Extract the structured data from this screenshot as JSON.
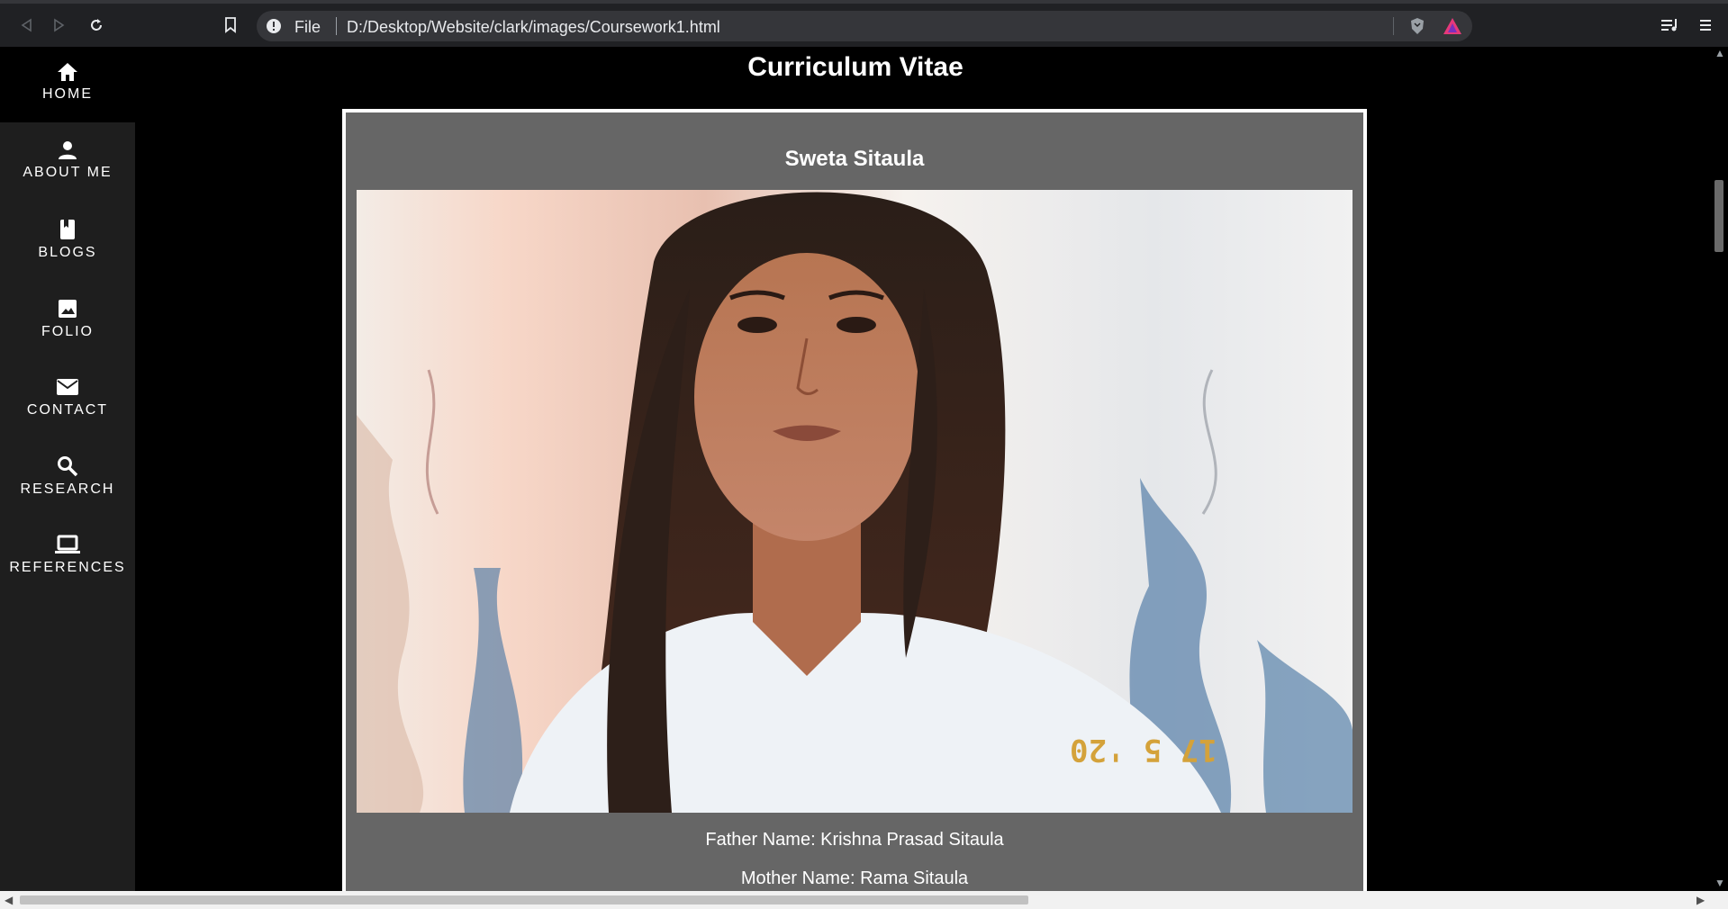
{
  "browser": {
    "scheme": "File",
    "url": "D:/Desktop/Website/clark/images/Coursework1.html"
  },
  "sidebar": {
    "items": [
      {
        "label": "HOME",
        "icon": "home-icon",
        "active": true
      },
      {
        "label": "ABOUT ME",
        "icon": "person-icon"
      },
      {
        "label": "BLOGS",
        "icon": "book-icon"
      },
      {
        "label": "FOLIO",
        "icon": "image-icon"
      },
      {
        "label": "CONTACT",
        "icon": "mail-icon"
      },
      {
        "label": "RESEARCH",
        "icon": "search-icon"
      },
      {
        "label": "REFERENCES",
        "icon": "laptop-icon"
      }
    ]
  },
  "main": {
    "title": "Curriculum Vitae",
    "name": "Sweta Sitaula",
    "photo_date_stamp": "17 5 '20",
    "father": "Father Name: Krishna Prasad Sitaula",
    "mother": "Mother Name: Rama Sitaula"
  },
  "colors": {
    "sidebar_bg": "#1e1e1e",
    "card_bg": "#666666",
    "page_bg": "#000000"
  }
}
